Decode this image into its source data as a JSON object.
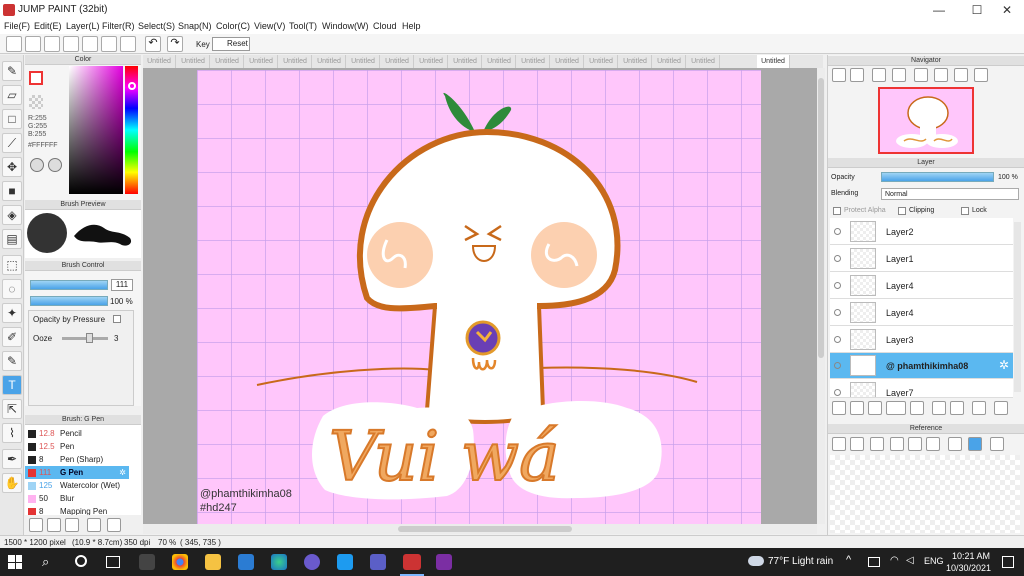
{
  "window": {
    "title": "JUMP PAINT (32bit)",
    "min": "—",
    "max": "☐",
    "close": "✕"
  },
  "menu": [
    "File(F)",
    "Edit(E)",
    "Layer(L)",
    "Filter(R)",
    "Select(S)",
    "Snap(N)",
    "Color(C)",
    "View(V)",
    "Tool(T)",
    "Window(W)",
    "Cloud",
    "Help"
  ],
  "toolbar": {
    "key_label": "Key",
    "reset_label": "Reset"
  },
  "color_panel": {
    "title": "Color",
    "r": "R:255",
    "g": "G:255",
    "b": "B:255",
    "hex": "#FFFFFF"
  },
  "brush_preview": {
    "title": "Brush Preview"
  },
  "brush_control": {
    "title": "Brush Control",
    "size": "111",
    "opacity": "100 %",
    "pressure_label": "Opacity by Pressure",
    "ooze_label": "Ooze",
    "ooze_value": "3"
  },
  "brush_list": {
    "title": "Brush: G Pen",
    "items": [
      {
        "size": "12.8",
        "name": "Pencil",
        "color": "#222222"
      },
      {
        "size": "12.5",
        "name": "Pen",
        "color": "#222222"
      },
      {
        "size": "8",
        "name": "Pen (Sharp)",
        "color": "#222222"
      },
      {
        "size": "111",
        "name": "G Pen",
        "color": "#e33333"
      },
      {
        "size": "125",
        "name": "Watercolor (Wet)",
        "color": "#9fd4f5"
      },
      {
        "size": "50",
        "name": "Blur",
        "color": "#ffb3f0"
      },
      {
        "size": "8",
        "name": "Mapping Pen",
        "color": "#e33333"
      }
    ]
  },
  "doc_tabs": [
    "Untitled",
    "Untitled",
    "Untitled",
    "Untitled",
    "Untitled",
    "Untitled",
    "Untitled",
    "Untitled",
    "Untitled",
    "Untitled",
    "Untitled",
    "Untitled",
    "Untitled",
    "Untitled",
    "Untitled",
    "Untitled",
    "Untitled",
    "Untitled"
  ],
  "canvas": {
    "handle": "@phamthikimha08",
    "hashtag": "#hd247",
    "artwork_text": "Vui wá",
    "bg_color": "#ffc6fb"
  },
  "navigator": {
    "title": "Navigator"
  },
  "layer_panel": {
    "title": "Layer",
    "opacity_label": "Opacity",
    "opacity_value": "100 %",
    "blending_label": "Blending",
    "blending_value": "Normal",
    "protect_alpha": "Protect Alpha",
    "clipping": "Clipping",
    "lock": "Lock",
    "layers": [
      "Layer2",
      "Layer1",
      "Layer4",
      "Layer4",
      "Layer3",
      "@ phamthikimha08",
      "Layer7"
    ]
  },
  "reference": {
    "title": "Reference"
  },
  "status": {
    "size": "1500 * 1200 pixel",
    "physical": "(10.9 * 8.7cm)",
    "dpi": "350 dpi",
    "zoom": "70 %",
    "coords": "( 345, 735 )"
  },
  "taskbar": {
    "weather": "77°F  Light rain",
    "lang": "ENG",
    "time": "10:21 AM",
    "date": "10/30/2021"
  }
}
